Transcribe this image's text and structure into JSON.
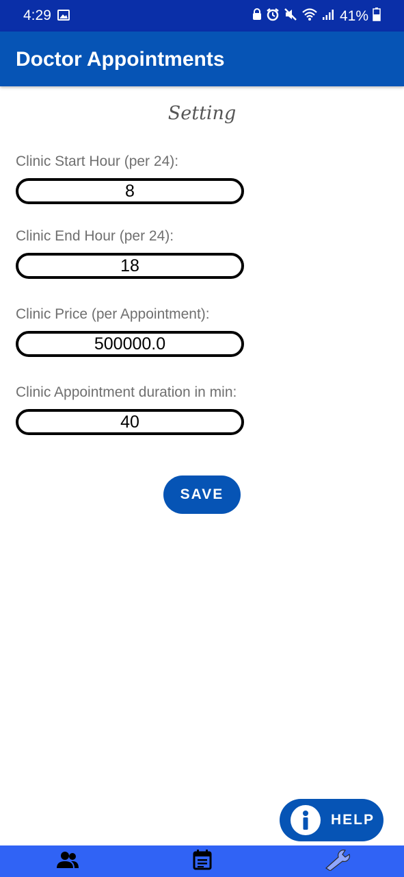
{
  "status_bar": {
    "time": "4:29",
    "battery": "41%",
    "icons": [
      "gallery-icon",
      "lock-icon",
      "alarm-icon",
      "mute-icon",
      "wifi-icon",
      "signal-icon",
      "battery-icon"
    ]
  },
  "app_bar": {
    "title": "Doctor Appointments"
  },
  "page": {
    "title": "Setting"
  },
  "fields": [
    {
      "label": "Clinic Start Hour (per 24):",
      "value": "8"
    },
    {
      "label": "Clinic End Hour (per 24):",
      "value": "18"
    },
    {
      "label": "Clinic Price (per Appointment):",
      "value": "500000.0"
    },
    {
      "label": "Clinic Appointment duration in min:",
      "value": "40"
    }
  ],
  "save_button": {
    "label": "SAVE"
  },
  "help_button": {
    "label": "HELP",
    "icon": "info-icon"
  },
  "bottom_nav": {
    "items": [
      {
        "icon": "people-icon"
      },
      {
        "icon": "calendar-icon"
      },
      {
        "icon": "wrench-icon"
      }
    ]
  },
  "colors": {
    "status_bar": "#0a2fa8",
    "app_bar": "#0654b5",
    "bottom_nav": "#3063f5",
    "accent": "#0654b5"
  }
}
